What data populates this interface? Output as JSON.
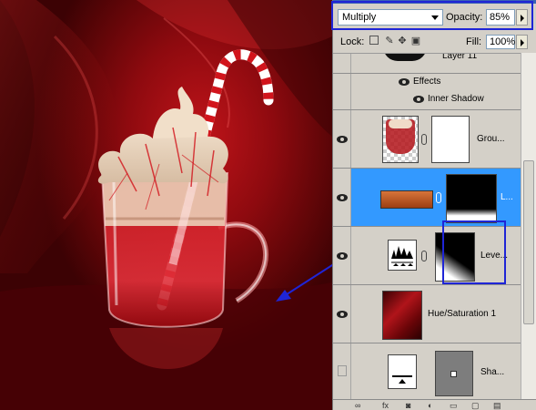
{
  "layers_panel": {
    "blend_mode": "Multiply",
    "opacity_label": "Opacity:",
    "opacity_value": "85%",
    "lock_label": "Lock:",
    "fill_label": "Fill:",
    "fill_value": "100%",
    "layers": [
      {
        "name": "Layer 11",
        "visible": false,
        "type": "partial-top"
      },
      {
        "name": "Effects",
        "type": "effects-header"
      },
      {
        "name": "Inner Shadow",
        "type": "effect"
      },
      {
        "name": "Grou...",
        "visible": true,
        "type": "group-masked"
      },
      {
        "name": "L...",
        "visible": true,
        "type": "selected-masked",
        "selected": true
      },
      {
        "name": "Leve...",
        "visible": true,
        "type": "adjustment-levels"
      },
      {
        "name": "Hue/Saturation 1",
        "visible": true,
        "type": "adjustment-hue"
      },
      {
        "name": "Sha...",
        "visible": false,
        "type": "shape-masked"
      }
    ]
  },
  "icons": {
    "eye": "eye-icon",
    "link": "chain-icon",
    "dropdown": "chevron-down-icon",
    "slider": "chevron-right-icon"
  },
  "colors": {
    "selection": "#3399ff",
    "annotation": "#1f25d6",
    "panel": "#d4d0c8"
  }
}
